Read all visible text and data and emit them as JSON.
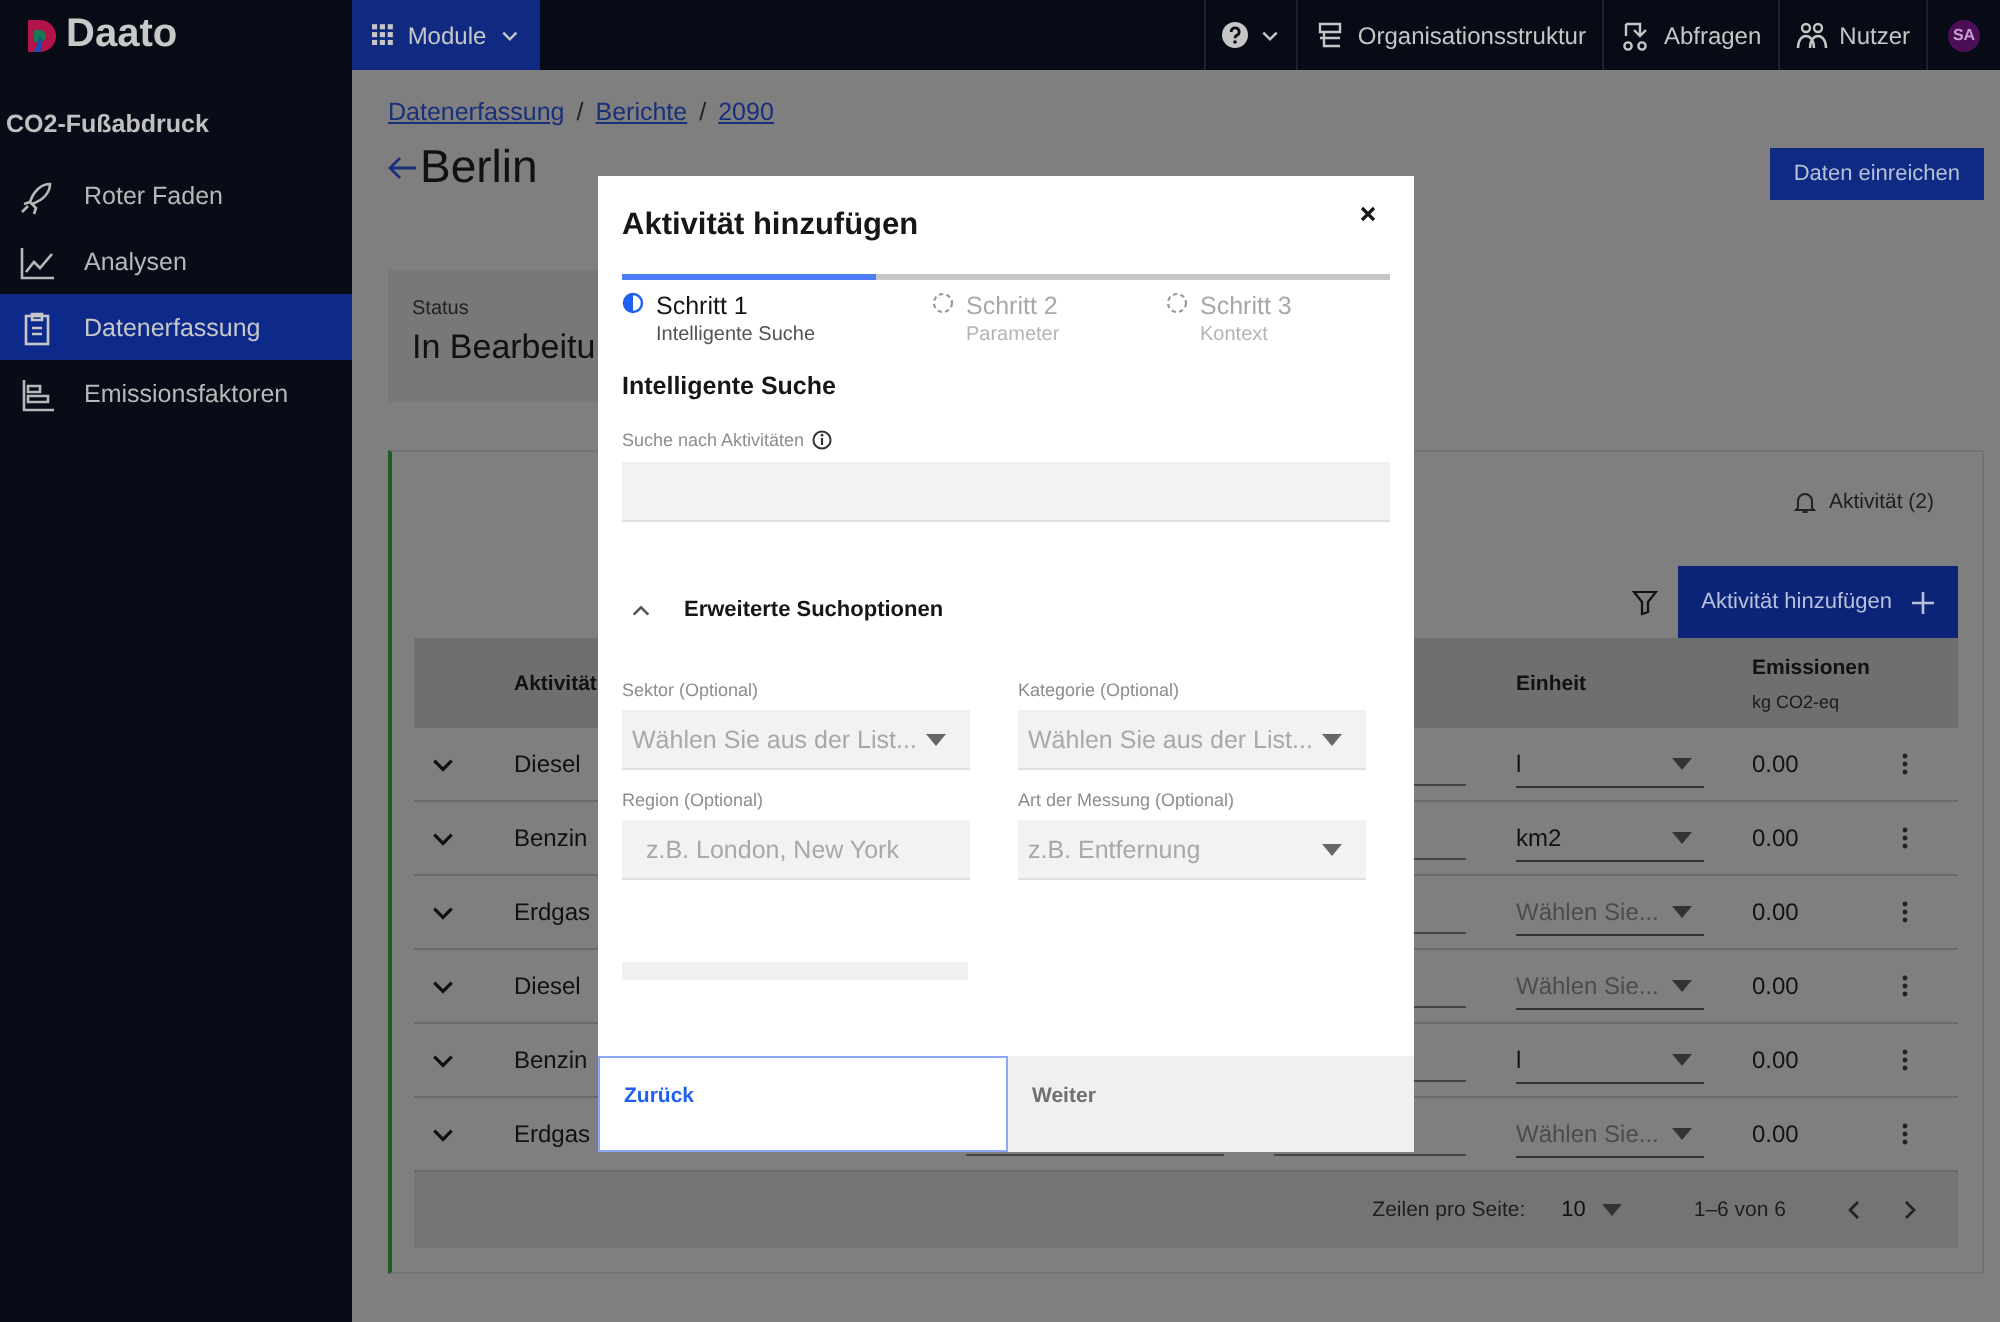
{
  "header": {
    "logo": "Daato",
    "module_menu": "Module",
    "nav": [
      "Organisationsstruktur",
      "Abfragen",
      "Nutzer"
    ],
    "avatar": "SA"
  },
  "sidebar": {
    "title": "CO2-Fußabdruck",
    "items": [
      {
        "label": "Roter Faden",
        "selected": false
      },
      {
        "label": "Analysen",
        "selected": false
      },
      {
        "label": "Datenerfassung",
        "selected": true
      },
      {
        "label": "Emissionsfaktoren",
        "selected": false
      }
    ]
  },
  "breadcrumb": {
    "separator": "/",
    "links": [
      "Datenerfassung",
      "Berichte",
      "2090"
    ]
  },
  "page": {
    "title": "Berlin",
    "submit_button": "Daten einreichen"
  },
  "status": {
    "label": "Status",
    "value": "In Bearbeitu"
  },
  "activity_panel": {
    "notifications": "Aktivität (2)",
    "add_button": "Aktivität hinzufügen",
    "columns": {
      "activity": "Aktivität",
      "unit": "Einheit",
      "emissions": "Emissionen",
      "emissions_unit": "kg CO2-eq"
    },
    "rows": [
      {
        "activity": "Diesel",
        "unit": "l",
        "unit_placeholder": false,
        "emissions": "0.00"
      },
      {
        "activity": "Benzin",
        "unit": "km2",
        "unit_placeholder": false,
        "emissions": "0.00"
      },
      {
        "activity": "Erdgas",
        "unit": "Wählen Sie...",
        "unit_placeholder": true,
        "emissions": "0.00"
      },
      {
        "activity": "Diesel",
        "unit": "Wählen Sie...",
        "unit_placeholder": true,
        "emissions": "0.00"
      },
      {
        "activity": "Benzin",
        "unit": "l",
        "unit_placeholder": false,
        "emissions": "0.00"
      },
      {
        "activity": "Erdgas",
        "unit": "Wählen Sie...",
        "unit_placeholder": true,
        "emissions": "0.00"
      }
    ],
    "pagination": {
      "rows_per_page_label": "Zeilen pro Seite:",
      "rows_per_page": "10",
      "range": "1–6 von 6"
    }
  },
  "modal": {
    "title": "Aktivität hinzufügen",
    "progress": {
      "level": 0.33
    },
    "steps": [
      {
        "title": "Schritt 1",
        "subtitle": "Intelligente Suche",
        "selected": true
      },
      {
        "title": "Schritt 2",
        "subtitle": "Parameter",
        "selected": false
      },
      {
        "title": "Schritt 3",
        "subtitle": "Kontext",
        "selected": false
      }
    ],
    "section_title": "Intelligente Suche",
    "search_label": "Suche nach Aktivitäten",
    "advanced": {
      "label": "Erweiterte Suchoptionen",
      "expanded": true
    },
    "fields": [
      {
        "label": "Sektor (Optional)",
        "kind": "select",
        "placeholder": "Wählen Sie aus der List..."
      },
      {
        "label": "Kategorie (Optional)",
        "kind": "select",
        "placeholder": "Wählen Sie aus der List..."
      },
      {
        "label": "Region (Optional)",
        "kind": "text",
        "placeholder": "z.B. London, New York"
      },
      {
        "label": "Art der Messung (Optional)",
        "kind": "select",
        "placeholder": "z.B. Entfernung"
      }
    ],
    "buttons": [
      {
        "label": "Zurück",
        "focused": true,
        "disabled": false
      },
      {
        "label": "Weiter",
        "focused": false,
        "disabled": true
      }
    ]
  }
}
